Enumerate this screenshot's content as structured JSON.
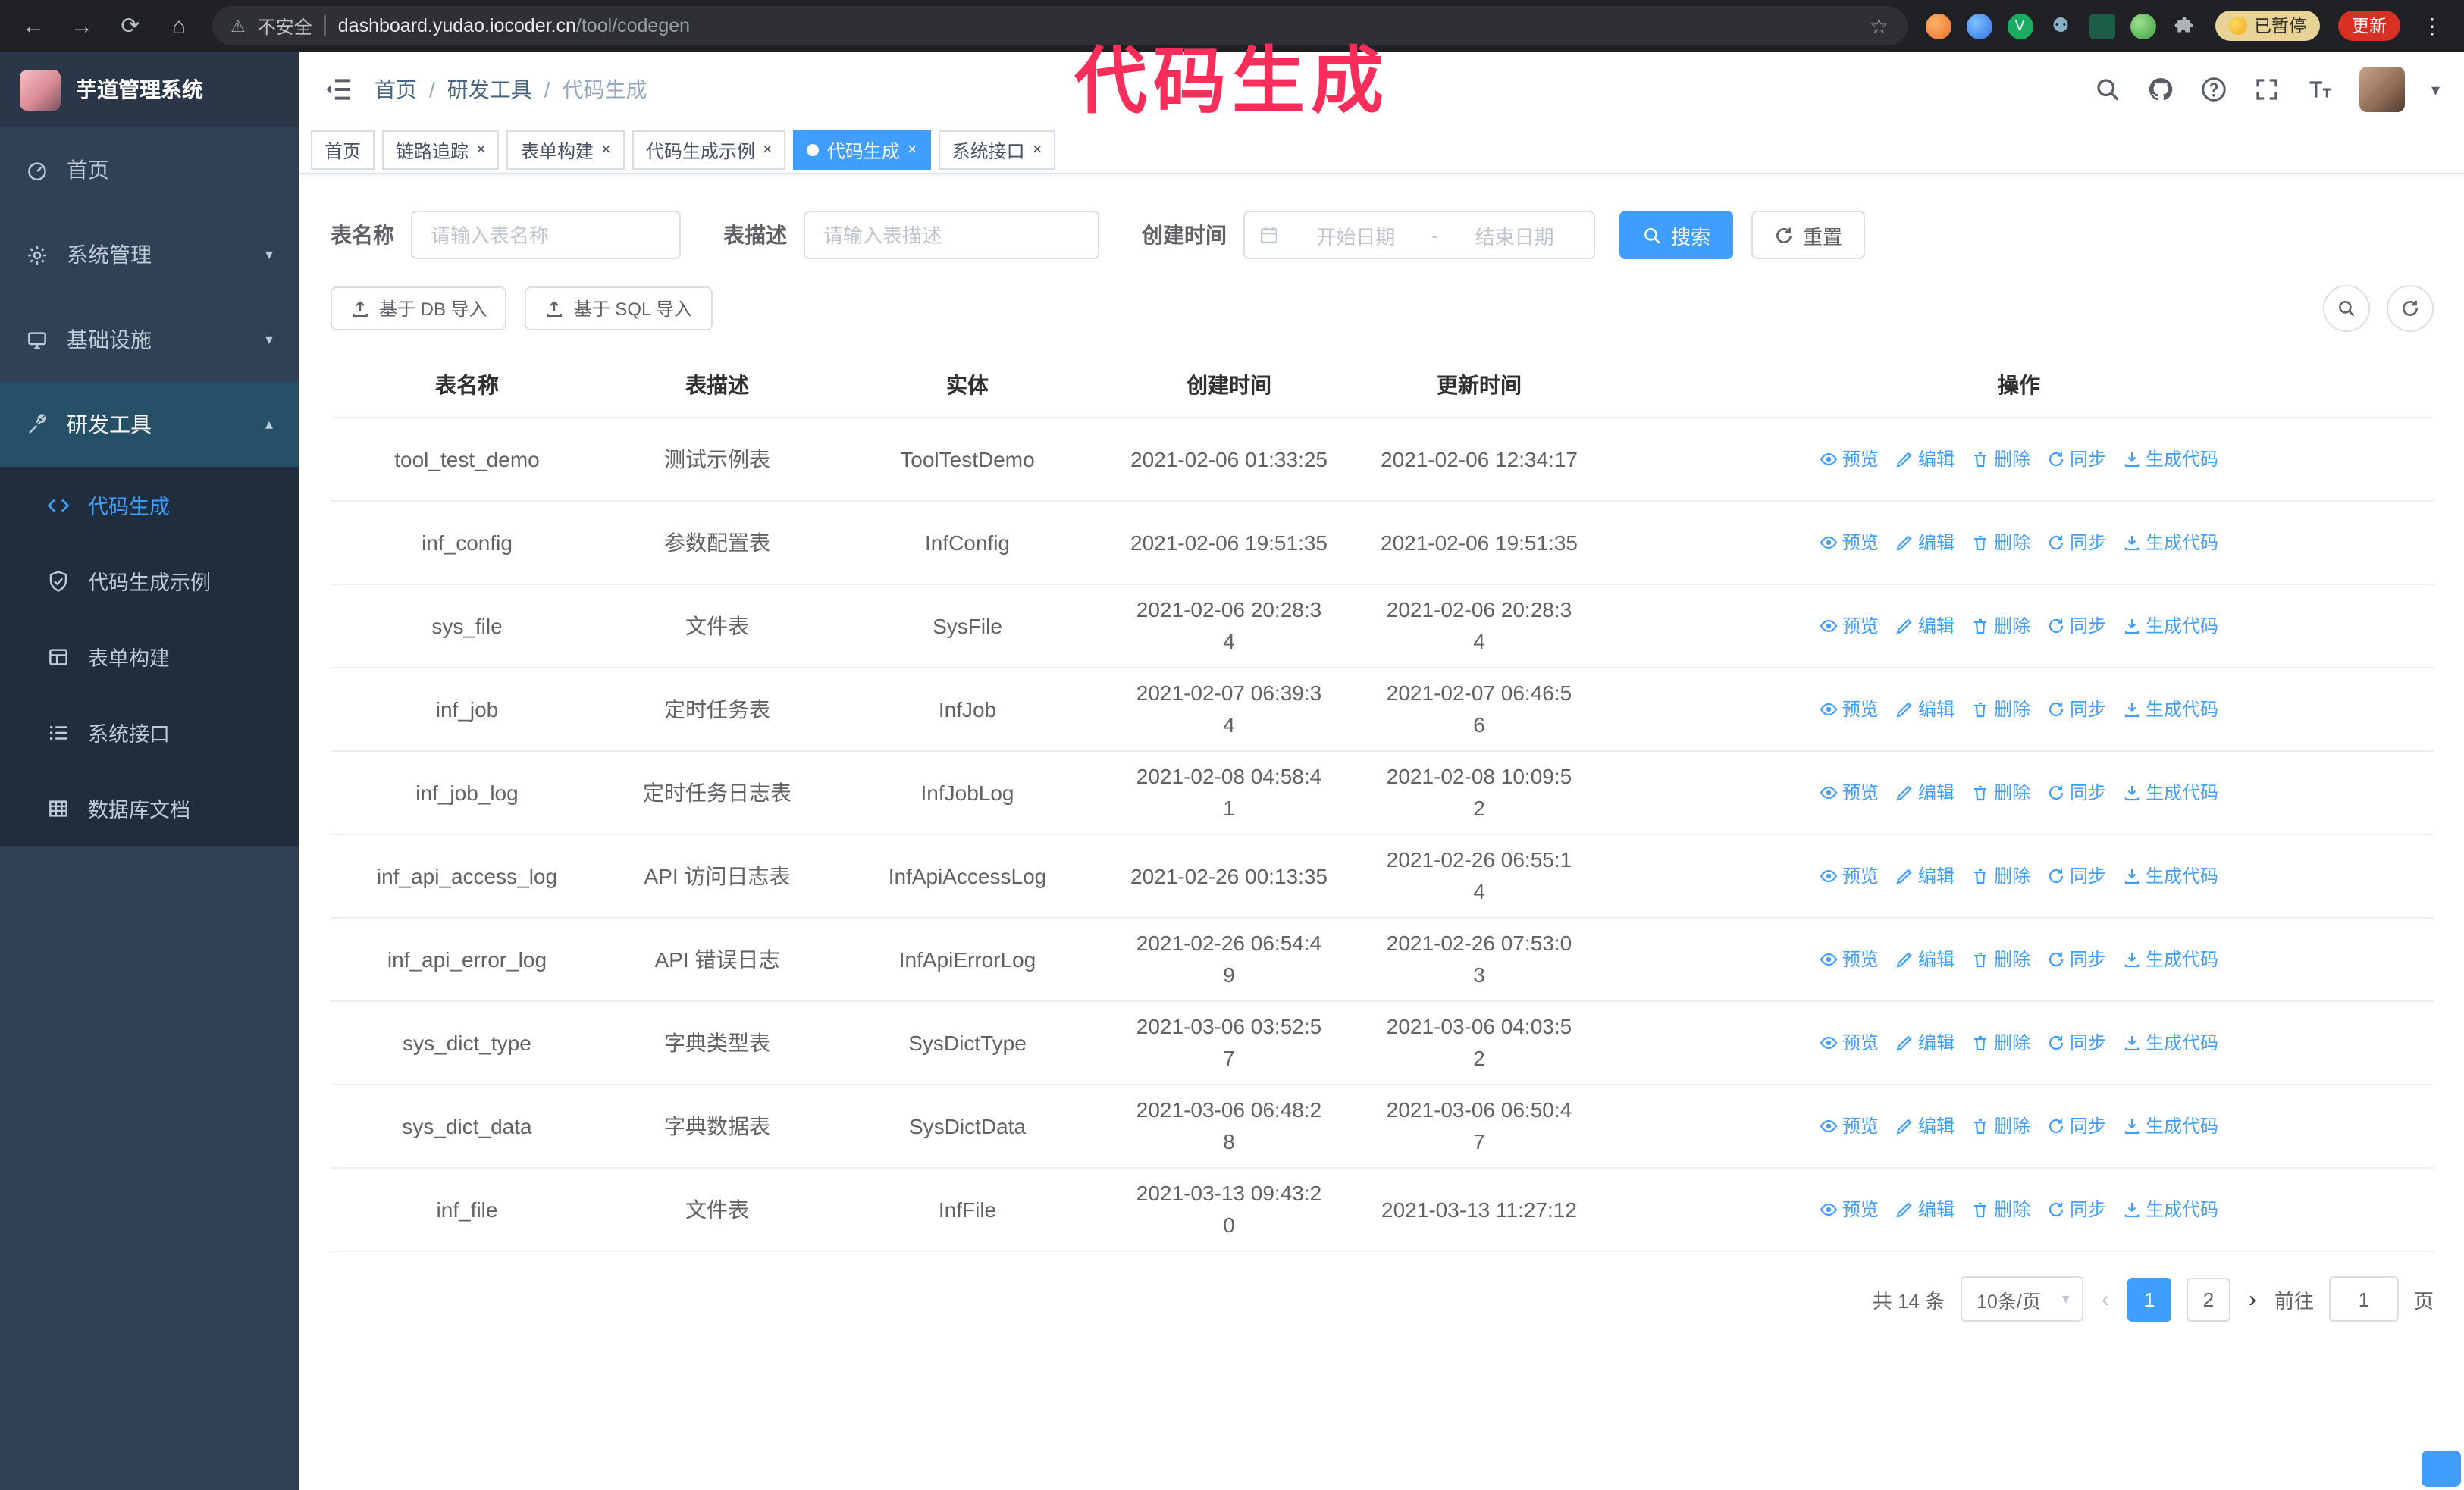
{
  "annotation": {
    "text": "代码生成",
    "color": "#fb2d5a"
  },
  "colors": {
    "accent": "#409EFF",
    "sidebar_bg": "#304156",
    "submenu_bg": "#1f2d3d",
    "chrome_bg": "#202124"
  },
  "browser": {
    "security_label": "不安全",
    "url_host": "dashboard.yudao.iocoder.cn",
    "url_path": "/tool/codegen",
    "paused_badge": "已暂停",
    "update_button": "更新"
  },
  "sidebar": {
    "logo_title": "芋道管理系统",
    "items": [
      {
        "label": "首页",
        "icon": "dashboard-icon"
      },
      {
        "label": "系统管理",
        "icon": "gear-icon",
        "chevron": "down"
      },
      {
        "label": "基础设施",
        "icon": "infrastructure-icon",
        "chevron": "down"
      },
      {
        "label": "研发工具",
        "icon": "tool-icon",
        "chevron": "up",
        "expanded": true
      }
    ],
    "subitems": [
      {
        "label": "代码生成",
        "icon": "code-icon",
        "active": true
      },
      {
        "label": "代码生成示例",
        "icon": "example-check-icon"
      },
      {
        "label": "表单构建",
        "icon": "form-builder-icon"
      },
      {
        "label": "系统接口",
        "icon": "api-list-icon"
      },
      {
        "label": "数据库文档",
        "icon": "db-doc-icon"
      }
    ]
  },
  "header": {
    "breadcrumb": [
      "首页",
      "研发工具",
      "代码生成"
    ]
  },
  "tabs": [
    {
      "label": "首页",
      "closable": false,
      "active": false
    },
    {
      "label": "链路追踪",
      "closable": true,
      "active": false
    },
    {
      "label": "表单构建",
      "closable": true,
      "active": false
    },
    {
      "label": "代码生成示例",
      "closable": true,
      "active": false
    },
    {
      "label": "代码生成",
      "closable": true,
      "active": true
    },
    {
      "label": "系统接口",
      "closable": true,
      "active": false
    }
  ],
  "filters": {
    "table_name_label": "表名称",
    "table_name_placeholder": "请输入表名称",
    "table_desc_label": "表描述",
    "table_desc_placeholder": "请输入表描述",
    "create_time_label": "创建时间",
    "date_start_placeholder": "开始日期",
    "date_separator": "-",
    "date_end_placeholder": "结束日期",
    "search_button": "搜索",
    "reset_button": "重置"
  },
  "toolbar": {
    "import_db_button": "基于 DB 导入",
    "import_sql_button": "基于 SQL 导入"
  },
  "table": {
    "columns": [
      "表名称",
      "表描述",
      "实体",
      "创建时间",
      "更新时间",
      "操作"
    ],
    "row_actions": [
      {
        "label": "预览",
        "icon": "eye-icon"
      },
      {
        "label": "编辑",
        "icon": "edit-icon"
      },
      {
        "label": "删除",
        "icon": "delete-icon"
      },
      {
        "label": "同步",
        "icon": "sync-icon"
      },
      {
        "label": "生成代码",
        "icon": "download-icon"
      }
    ],
    "rows": [
      {
        "name": "tool_test_demo",
        "desc": "测试示例表",
        "entity": "ToolTestDemo",
        "created": "2021-02-06 01:33:25",
        "updated": "2021-02-06 12:34:17"
      },
      {
        "name": "inf_config",
        "desc": "参数配置表",
        "entity": "InfConfig",
        "created": "2021-02-06 19:51:35",
        "updated": "2021-02-06 19:51:35"
      },
      {
        "name": "sys_file",
        "desc": "文件表",
        "entity": "SysFile",
        "created": "2021-02-06 20:28:3\n4",
        "updated": "2021-02-06 20:28:3\n4"
      },
      {
        "name": "inf_job",
        "desc": "定时任务表",
        "entity": "InfJob",
        "created": "2021-02-07 06:39:3\n4",
        "updated": "2021-02-07 06:46:5\n6"
      },
      {
        "name": "inf_job_log",
        "desc": "定时任务日志表",
        "entity": "InfJobLog",
        "created": "2021-02-08 04:58:4\n1",
        "updated": "2021-02-08 10:09:5\n2"
      },
      {
        "name": "inf_api_access_log",
        "desc": "API 访问日志表",
        "entity": "InfApiAccessLog",
        "created": "2021-02-26 00:13:35",
        "updated": "2021-02-26 06:55:1\n4"
      },
      {
        "name": "inf_api_error_log",
        "desc": "API 错误日志",
        "entity": "InfApiErrorLog",
        "created": "2021-02-26 06:54:4\n9",
        "updated": "2021-02-26 07:53:0\n3"
      },
      {
        "name": "sys_dict_type",
        "desc": "字典类型表",
        "entity": "SysDictType",
        "created": "2021-03-06 03:52:5\n7",
        "updated": "2021-03-06 04:03:5\n2"
      },
      {
        "name": "sys_dict_data",
        "desc": "字典数据表",
        "entity": "SysDictData",
        "created": "2021-03-06 06:48:2\n8",
        "updated": "2021-03-06 06:50:4\n7"
      },
      {
        "name": "inf_file",
        "desc": "文件表",
        "entity": "InfFile",
        "created": "2021-03-13 09:43:2\n0",
        "updated": "2021-03-13 11:27:12"
      }
    ]
  },
  "pagination": {
    "total_text": "共 14 条",
    "page_size": "10条/页",
    "pages": [
      "1",
      "2"
    ],
    "active_page": "1",
    "goto_label": "前往",
    "goto_value": "1",
    "goto_unit": "页"
  }
}
